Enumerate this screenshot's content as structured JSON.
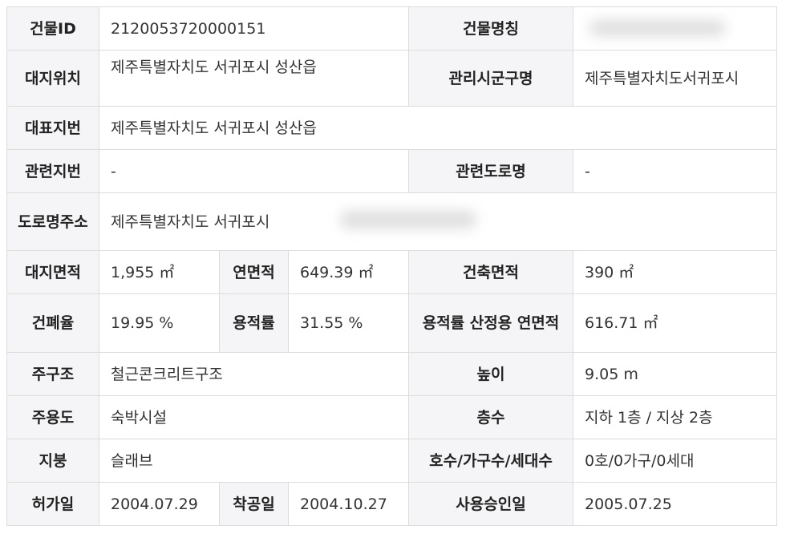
{
  "rows": {
    "building_id": {
      "label": "건물ID",
      "value": "2120053720000151"
    },
    "building_name": {
      "label": "건물명칭",
      "value": ""
    },
    "site_location": {
      "label": "대지위치",
      "value": "제주특별자치도 서귀포시 성산읍"
    },
    "admin_district": {
      "label": "관리시군구명",
      "value": "제주특별자치도서귀포시"
    },
    "main_lot": {
      "label": "대표지번",
      "value": "제주특별자치도 서귀포시 성산읍"
    },
    "related_lot": {
      "label": "관련지번",
      "value": "-"
    },
    "related_road": {
      "label": "관련도로명",
      "value": "-"
    },
    "road_address": {
      "label": "도로명주소",
      "value": "제주특별자치도 서귀포시"
    },
    "site_area": {
      "label": "대지면적",
      "value": "1,955 ㎡"
    },
    "total_floor_area": {
      "label": "연면적",
      "value": "649.39 ㎡"
    },
    "building_area": {
      "label": "건축면적",
      "value": "390 ㎡"
    },
    "coverage_ratio": {
      "label": "건폐율",
      "value": "19.95 %"
    },
    "floor_area_ratio": {
      "label": "용적률",
      "value": "31.55 %"
    },
    "far_floor_area": {
      "label": "용적률 산정용 연면적",
      "value": "616.71 ㎡"
    },
    "main_structure": {
      "label": "주구조",
      "value": "철근콘크리트구조"
    },
    "height": {
      "label": "높이",
      "value": "9.05 m"
    },
    "main_use": {
      "label": "주용도",
      "value": "숙박시설"
    },
    "floors": {
      "label": "층수",
      "value": "지하 1층 / 지상 2층"
    },
    "roof": {
      "label": "지붕",
      "value": "슬래브"
    },
    "units": {
      "label": "호수/가구수/세대수",
      "value": "0호/0가구/0세대"
    },
    "permit_date": {
      "label": "허가일",
      "value": "2004.07.29"
    },
    "construction_start": {
      "label": "착공일",
      "value": "2004.10.27"
    },
    "approval_date": {
      "label": "사용승인일",
      "value": "2005.07.25"
    }
  }
}
